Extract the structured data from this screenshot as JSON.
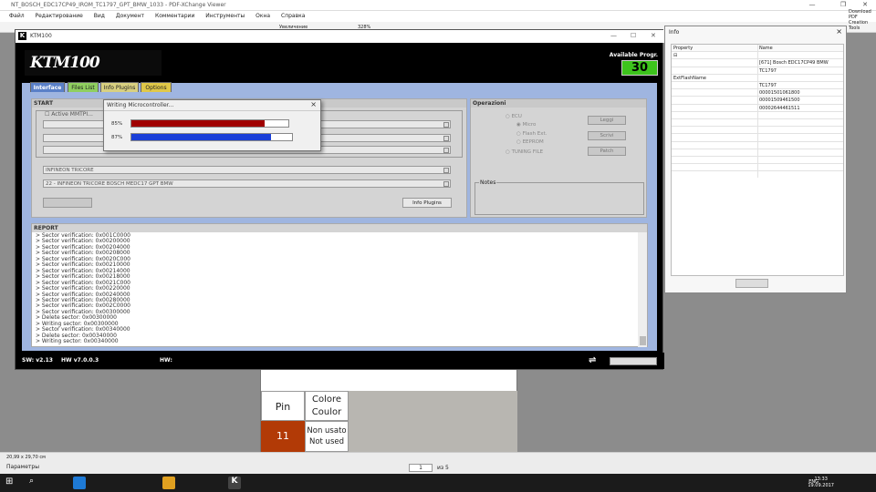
{
  "pdf_viewer": {
    "title": "NT_BOSCH_EDC17CP49_IROM_TC1797_GPT_BMW_1033 - PDF-XChange Viewer",
    "menu": [
      "Файл",
      "Редактирование",
      "Вид",
      "Документ",
      "Комментарии",
      "Инструменты",
      "Окна",
      "Справка"
    ],
    "toolbar": {
      "zoom_label": "Увеличение",
      "zoom_value": "328%"
    },
    "download_pdf": "Download PDF Creation Tools",
    "page_size": "20,99 x 29,70 см",
    "params_label": "Параметры",
    "page_current": "1",
    "page_total": "из 5",
    "page_table": {
      "header_pin": "Pin",
      "header_color": "Colore Coulor",
      "row_pin": "11",
      "row_color": "Non usato Not used"
    }
  },
  "ktm": {
    "title": "KTM100",
    "logo": "KTM100",
    "available_label": "Available Progr.",
    "available_value": "30",
    "tabs": [
      "Interface",
      "Files List",
      "Info Plugins",
      "Options"
    ],
    "start": {
      "header": "START",
      "active_mmtpi": "Active MMTPI...",
      "family": "INFINEON TRICORE",
      "plugin": "22 - INFINEON TRICORE BOSCH MEDC17 GPT BMW",
      "info_plugins_button": "Info Plugins"
    },
    "operazioni": {
      "header": "Operazioni",
      "ecu": "ECU",
      "micro": "Micro",
      "flash_ext": "Flash Ext.",
      "eeprom": "EEPROM",
      "tuning_file": "TUNING FILE",
      "buttons": [
        "Leggi",
        "Scrivi",
        "Patch"
      ],
      "notes_label": "Notes"
    },
    "report": {
      "header": "REPORT",
      "lines": [
        ">   Sector verification: 0x001C0000",
        ">   Sector verification: 0x00200000",
        ">   Sector verification: 0x00204000",
        ">   Sector verification: 0x00208000",
        ">   Sector verification: 0x0020C000",
        ">   Sector verification: 0x00210000",
        ">   Sector verification: 0x00214000",
        ">   Sector verification: 0x00218000",
        ">   Sector verification: 0x0021C000",
        ">   Sector verification: 0x00220000",
        ">   Sector verification: 0x00240000",
        ">   Sector verification: 0x00280000",
        ">   Sector verification: 0x002C0000",
        ">   Sector verification: 0x00300000",
        ">   Delete sector: 0x00300000",
        ">   Writing sector: 0x00300000",
        ">   Sector verification: 0x00340000",
        ">   Delete sector: 0x00340000",
        ">   Writing sector: 0x00340000"
      ]
    },
    "status": {
      "sw": "SW: v2.13",
      "hw": "HW v7.0.0.3",
      "hw2": "HW:"
    }
  },
  "dialog": {
    "title": "Writing Microcontroller...",
    "progress1_label": "85%",
    "progress1": 0.85,
    "progress1_color": "#a00000",
    "progress2_label": "87%",
    "progress2": 0.87,
    "progress2_color": "#1a3fd8"
  },
  "info_window": {
    "title": "Info",
    "col_property": "Property",
    "col_name": "Name",
    "rows": [
      {
        "p": "⊟",
        "n": ""
      },
      {
        "p": "",
        "n": "[671] Bosch EDC17CP49 BMW"
      },
      {
        "p": "",
        "n": "TC1797"
      },
      {
        "p": "ExtFlashName",
        "n": ""
      },
      {
        "p": "",
        "n": "TC1797"
      },
      {
        "p": "",
        "n": "00001501061800"
      },
      {
        "p": "",
        "n": "00001509461500"
      },
      {
        "p": "",
        "n": "00002644461511"
      },
      {
        "p": "",
        "n": ""
      },
      {
        "p": "",
        "n": ""
      },
      {
        "p": "",
        "n": ""
      },
      {
        "p": "",
        "n": ""
      },
      {
        "p": "",
        "n": ""
      },
      {
        "p": "",
        "n": ""
      },
      {
        "p": "",
        "n": ""
      },
      {
        "p": "",
        "n": ""
      }
    ]
  },
  "taskbar": {
    "time": "13:33",
    "date": "19.09.2017",
    "lang": "ENG"
  }
}
